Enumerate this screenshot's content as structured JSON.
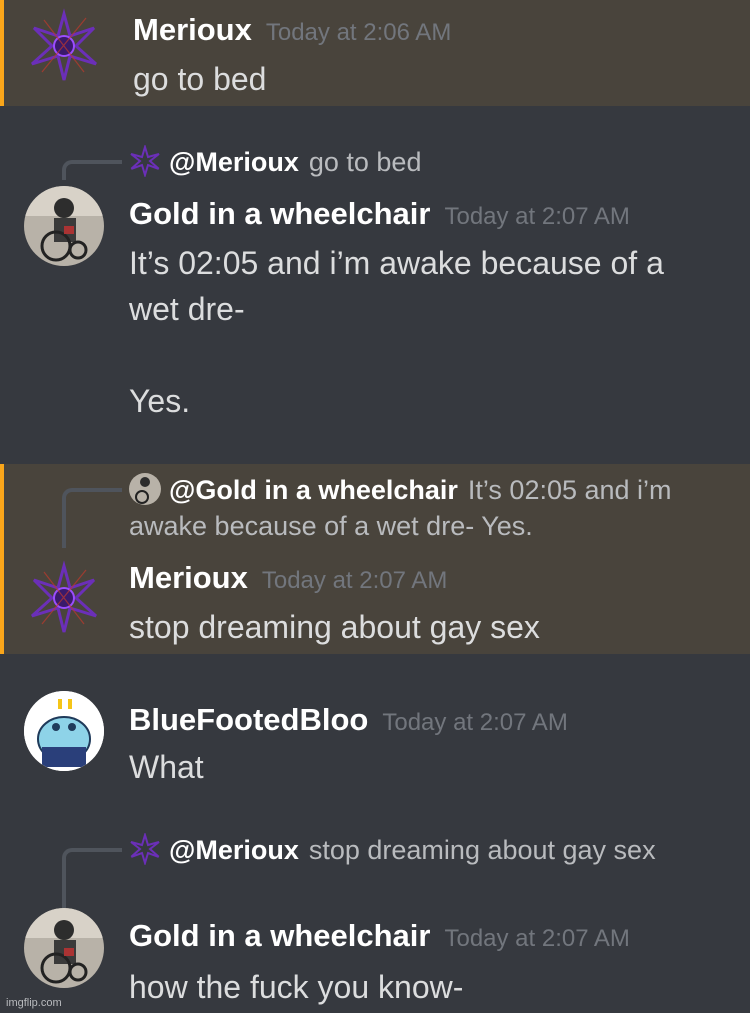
{
  "messages": [
    {
      "author": "Merioux",
      "time": "Today at 2:06 AM",
      "text": "go to bed"
    },
    {
      "reply_to": "@Merioux",
      "reply_text": "go to bed",
      "author": "Gold in a wheelchair",
      "time": "Today at 2:07 AM",
      "text": "It’s 02:05 and i’m awake because of a\nwet dre-\n\nYes."
    },
    {
      "reply_to": "@Gold in a wheelchair",
      "reply_text": "It’s 02:05 and i’m awake because of a wet dre-  Yes.",
      "author": "Merioux",
      "time": "Today at 2:07 AM",
      "text": "stop dreaming about gay sex"
    },
    {
      "author": "BlueFootedBloo",
      "time": "Today at 2:07 AM",
      "text": "What"
    },
    {
      "reply_to": "@Merioux",
      "reply_text": "stop dreaming about gay sex",
      "author": "Gold in a wheelchair",
      "time": "Today at 2:07 AM",
      "text": "how the fuck you know-"
    }
  ],
  "watermark": "imgflip.com",
  "colors": {
    "highlight_bg": "#49443c",
    "highlight_bar": "#faa61a",
    "background": "#36393f"
  },
  "icons": {
    "merioux_avatar": "purple-star-icon",
    "gold_avatar": "wheelchair-icon",
    "bloo_avatar": "blue-creature-icon"
  }
}
